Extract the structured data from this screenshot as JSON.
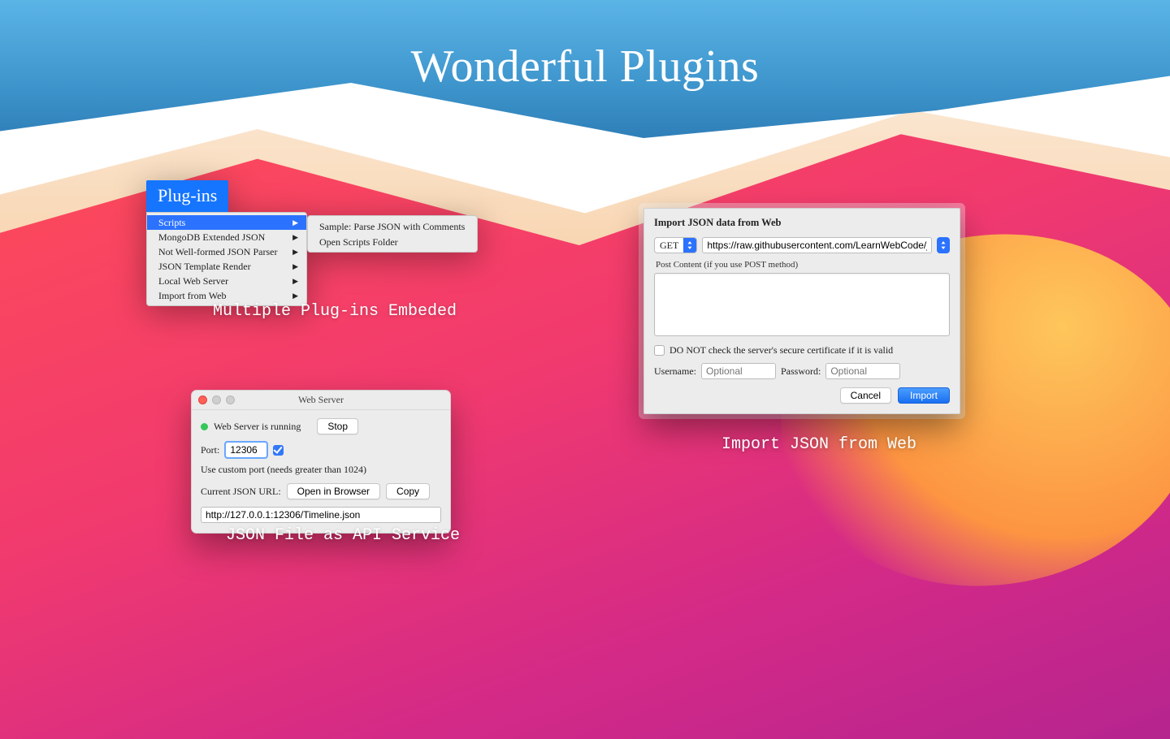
{
  "page": {
    "title": "Wonderful Plugins",
    "captions": {
      "plugins": "Multiple Plug-ins Embeded",
      "webserver": "JSON File as API Service",
      "import": "Import JSON from Web"
    }
  },
  "plugins_menu": {
    "header": "Plug-ins",
    "items": [
      "Scripts",
      "MongoDB Extended JSON",
      "Not Well-formed JSON Parser",
      "JSON Template Render",
      "Local Web Server",
      "Import from Web"
    ],
    "selected_index": 0,
    "submenu": [
      "Sample: Parse JSON with Comments",
      "Open Scripts Folder"
    ]
  },
  "webserver": {
    "window_title": "Web Server",
    "status_text": "Web Server is running",
    "stop_button": "Stop",
    "port_label": "Port:",
    "port_value": "12306",
    "custom_port_label": "Use custom port (needs greater than 1024)",
    "current_url_label": "Current JSON URL:",
    "open_browser_button": "Open in Browser",
    "copy_button": "Copy",
    "url_value": "http://127.0.0.1:12306/Timeline.json"
  },
  "import_dialog": {
    "heading": "Import JSON data from Web",
    "method": "GET",
    "url_value": "https://raw.githubusercontent.com/LearnWebCode/json-example",
    "post_label": "Post Content (if you use POST method)",
    "cert_checkbox_label": "DO NOT check the server's secure certificate if it is valid",
    "username_label": "Username:",
    "username_placeholder": "Optional",
    "password_label": "Password:",
    "password_placeholder": "Optional",
    "cancel_button": "Cancel",
    "import_button": "Import"
  }
}
